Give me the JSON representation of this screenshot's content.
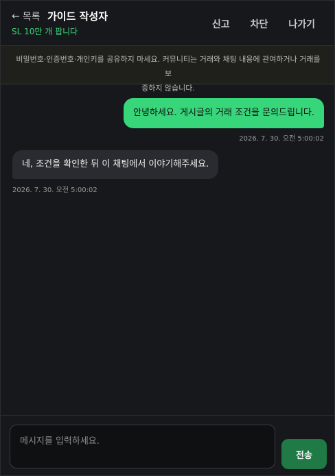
{
  "header": {
    "back_arrow": "←",
    "back_label": "목록",
    "title": "가이드 작성자",
    "subtitle": "SL 10만 개 팝니다",
    "actions": [
      "신고",
      "차단",
      "나가기"
    ]
  },
  "notice": {
    "line1": "비밀번호·인증번호·개인키를 공유하지 마세요. 커뮤니티는 거래와 채팅 내용에 관여하거나 거래를 보",
    "line2": "증하지 않습니다."
  },
  "messages": [
    {
      "sender": "me",
      "text": "안녕하세요. 게시글의 거래 조건을 문의드립니다.",
      "time": "2026. 7. 30. 오전 5:00:02"
    },
    {
      "sender": "other",
      "text": "네, 조건을 확인한 뒤 이 채팅에서 이야기해주세요.",
      "time": "2026. 7. 30. 오전 5:00:02"
    }
  ],
  "composer": {
    "placeholder": "메시지를 입력하세요.",
    "value": "",
    "send_label": "전송"
  },
  "colors": {
    "accent": "#37d67a",
    "send_button": "#1f7a45",
    "background": "#17181b",
    "bubble_other": "#2a2b30"
  }
}
